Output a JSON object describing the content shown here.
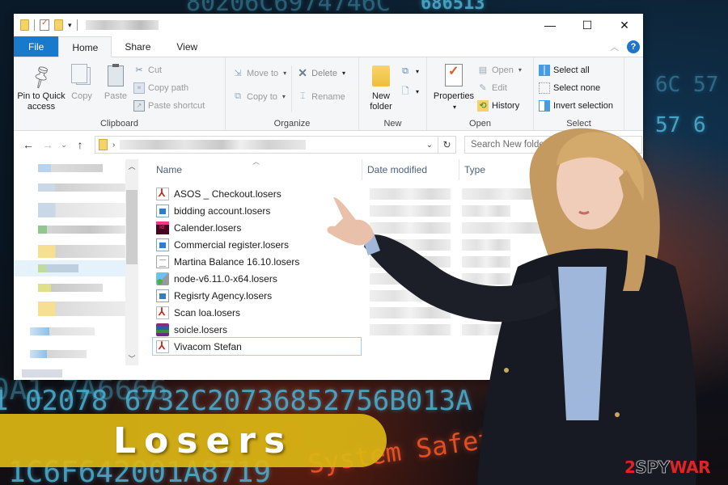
{
  "background": {
    "code_lines": [
      "80206C6974746C",
      "686513",
      "6C 57",
      "57 6",
      "0A1 7A6666",
      "1 02078 6732C20736852756B013A 07",
      "1C6F642001A8719",
      "System Safety"
    ]
  },
  "window": {
    "title_obscured": true,
    "controls": {
      "minimize": "—",
      "maximize": "☐",
      "close": "✕"
    },
    "tabs": [
      {
        "label": "File",
        "active": false
      },
      {
        "label": "Home",
        "active": true
      },
      {
        "label": "Share",
        "active": false
      },
      {
        "label": "View",
        "active": false
      }
    ],
    "help_label": "?",
    "ribbon": {
      "clipboard": {
        "label": "Clipboard",
        "pin": "Pin to Quick access",
        "pin_line1": "Pin to Quick",
        "pin_line2": "access",
        "copy": "Copy",
        "paste": "Paste",
        "cut": "Cut",
        "copy_path": "Copy path",
        "paste_shortcut": "Paste shortcut"
      },
      "organize": {
        "label": "Organize",
        "move_to": "Move to",
        "copy_to": "Copy to",
        "delete": "Delete",
        "rename": "Rename"
      },
      "new": {
        "label": "New",
        "new_folder_line1": "New",
        "new_folder_line2": "folder"
      },
      "open": {
        "label": "Open",
        "properties": "Properties",
        "open": "Open",
        "edit": "Edit",
        "history": "History"
      },
      "select": {
        "label": "Select",
        "select_all": "Select all",
        "select_none": "Select none",
        "invert_selection": "Invert selection"
      }
    },
    "navbar": {
      "back": "←",
      "forward": "→",
      "recent": "⌄",
      "up": "↑",
      "address_obscured": true,
      "refresh": "↻",
      "search_placeholder": "Search New folder (2)"
    },
    "columns": {
      "name": "Name",
      "date_modified": "Date modified",
      "type": "Type"
    },
    "files": [
      {
        "name": "ASOS _ Checkout.losers",
        "icon": "pdf-icon"
      },
      {
        "name": "bidding account.losers",
        "icon": "image-icon"
      },
      {
        "name": "Calender.losers",
        "icon": "indesign-icon"
      },
      {
        "name": "Commercial register.losers",
        "icon": "image-icon"
      },
      {
        "name": "Martina Balance 16.10.losers",
        "icon": "text-file-icon"
      },
      {
        "name": "node-v6.11.0-x64.losers",
        "icon": "installer-icon"
      },
      {
        "name": "Regisrty Agency.losers",
        "icon": "image-icon"
      },
      {
        "name": "Scan loa.losers",
        "icon": "pdf-icon"
      },
      {
        "name": "soicle.losers",
        "icon": "archive-icon"
      },
      {
        "name": "Vivacom Stefan",
        "icon": "pdf-icon",
        "focused": true
      }
    ]
  },
  "banner": {
    "title": "Losers",
    "color": "#dab614"
  },
  "watermark": {
    "part1": "2",
    "part2": "SPY",
    "part3": "WAR"
  }
}
